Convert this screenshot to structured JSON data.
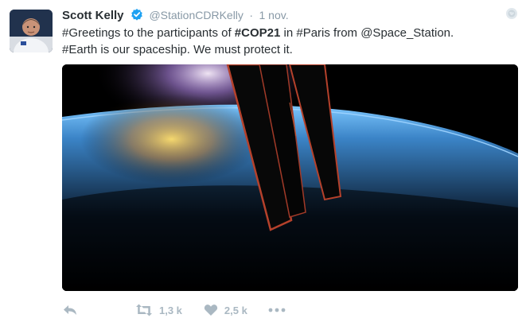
{
  "tweet": {
    "author_name": "Scott Kelly",
    "author_handle": "@StationCDRKelly",
    "separator": "·",
    "time": "1 nov.",
    "line1": [
      {
        "text": "#Greetings to the participants of ",
        "bold": false
      },
      {
        "text": "#COP21",
        "bold": true
      },
      {
        "text": " in #Paris from @Space_Station.",
        "bold": false
      }
    ],
    "line2": "#Earth is our spaceship. We must protect it.",
    "retweet_count": "1,3 k",
    "like_count": "2,5 k"
  },
  "icons": {
    "verified": "verified-badge-icon",
    "caret": "globe-icon",
    "reply": "reply-icon",
    "retweet": "retweet-icon",
    "like": "heart-icon",
    "more": "more-dots-icon"
  },
  "colors": {
    "text": "#292f33",
    "muted": "#8899a6",
    "action": "#aab8c2",
    "verified": "#1da1f2"
  }
}
